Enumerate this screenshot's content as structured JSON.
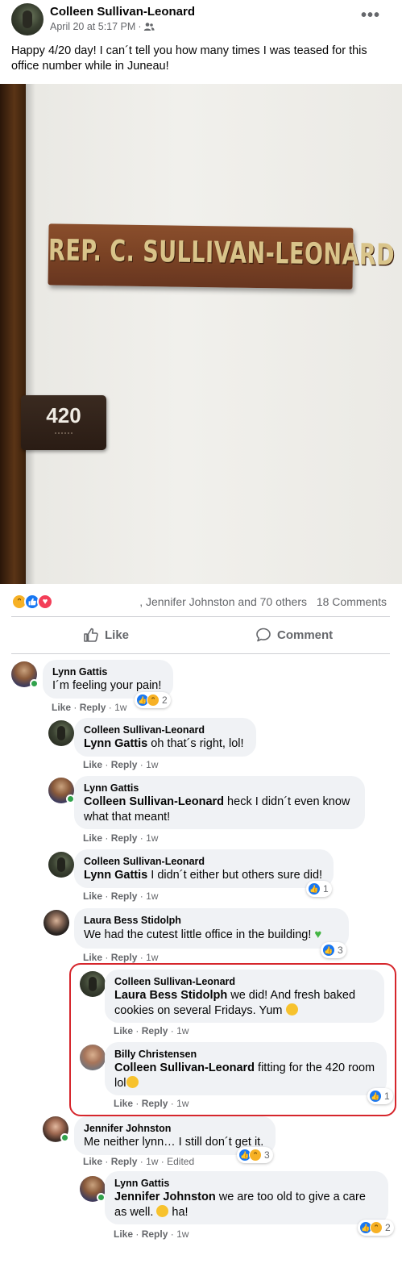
{
  "post": {
    "author": "Colleen Sullivan-Leonard",
    "timestamp": "April 20 at 5:17 PM",
    "separator": "·",
    "audience_icon": "friends-icon",
    "more_icon": "more-options-icon",
    "text": "Happy 4/20 day! I can´t tell you how many times I was teased for this office number while in Juneau!",
    "photo": {
      "nameplate_text": "REP. C. SULLIVAN-LEONARD",
      "room_number": "420"
    }
  },
  "reactions_bar": {
    "icons": [
      "haha-reaction-icon",
      "like-reaction-icon",
      "love-reaction-icon"
    ],
    "reactors_text": ", Jennifer Johnston and 70 others",
    "comments_count": "18 Comments"
  },
  "actions": {
    "like_label": "Like",
    "comment_label": "Comment"
  },
  "comments": [
    {
      "author": "Lynn Gattis",
      "mention": "",
      "text": "I´m feeling your pain!",
      "like": "Like",
      "reply": "Reply",
      "sep": "·",
      "age": "1w",
      "edited": "",
      "reaction_count": "2"
    },
    {
      "author": "Colleen Sullivan-Leonard",
      "mention": "Lynn Gattis",
      "text": " oh that´s right, lol!",
      "like": "Like",
      "reply": "Reply",
      "sep": "·",
      "age": "1w",
      "edited": "",
      "reaction_count": ""
    },
    {
      "author": "Lynn Gattis",
      "mention": "Colleen Sullivan-Leonard",
      "text": " heck I didn´t even know what that meant!",
      "like": "Like",
      "reply": "Reply",
      "sep": "·",
      "age": "1w",
      "edited": "",
      "reaction_count": ""
    },
    {
      "author": "Colleen Sullivan-Leonard",
      "mention": "Lynn Gattis",
      "text": " I didn´t either but others sure did!",
      "like": "Like",
      "reply": "Reply",
      "sep": "·",
      "age": "1w",
      "edited": "",
      "reaction_count": "1"
    },
    {
      "author": "Laura Bess Stidolph",
      "mention": "",
      "text": "We had the cutest little office in the building! ",
      "like": "Like",
      "reply": "Reply",
      "sep": "·",
      "age": "1w",
      "edited": "",
      "reaction_count": "3"
    },
    {
      "author": "Colleen Sullivan-Leonard",
      "mention": "Laura Bess Stidolph",
      "text": " we did! And fresh baked cookies on several Fridays. Yum ",
      "like": "Like",
      "reply": "Reply",
      "sep": "·",
      "age": "1w",
      "edited": "",
      "reaction_count": ""
    },
    {
      "author": "Billy Christensen",
      "mention": "Colleen Sullivan-Leonard",
      "text": " fitting for the 420 room lol",
      "like": "Like",
      "reply": "Reply",
      "sep": "·",
      "age": "1w",
      "edited": "",
      "reaction_count": "1"
    },
    {
      "author": "Jennifer Johnston",
      "mention": "",
      "text": "Me neither lynn… I still don´t get it.",
      "like": "Like",
      "reply": "Reply",
      "sep": "·",
      "age": "1w",
      "edited": "· Edited",
      "reaction_count": "3"
    },
    {
      "author": "Lynn Gattis",
      "mention": "Jennifer Johnston",
      "text": " we are too old to give a care as well. ",
      "text_after": " ha!",
      "like": "Like",
      "reply": "Reply",
      "sep": "·",
      "age": "1w",
      "edited": "",
      "reaction_count": "2"
    }
  ],
  "colors": {
    "link_blue": "#1877f2",
    "secondary_text": "#65676b",
    "bubble_bg": "#f0f2f5",
    "online_green": "#31a24c",
    "highlight_red": "#d6262c"
  }
}
